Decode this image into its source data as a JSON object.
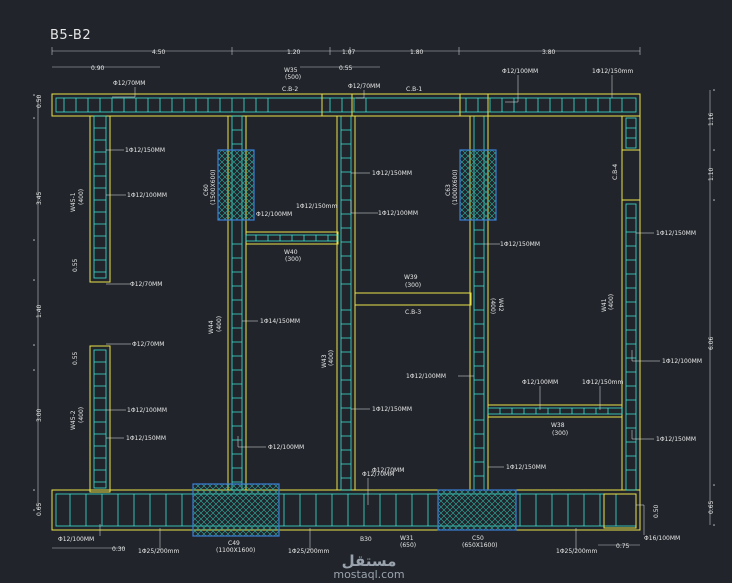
{
  "title": "B5-B2",
  "colors": {
    "background": "#21252b",
    "wall": "#e9e34a",
    "rebar": "#3fe3d4",
    "column": "#3a7fd6",
    "text": "#e6e6e6"
  },
  "dimensions": {
    "top_row": [
      "4.50",
      "1.20",
      "1.07",
      "1.80",
      "3.80"
    ],
    "second_row": [
      "0.90",
      "0.55"
    ],
    "left_col": [
      "0.50",
      "3.45",
      "0.55",
      "1.40",
      "0.55",
      "3.00",
      "0.65"
    ],
    "right_col": [
      "1.16",
      "1.10",
      "6.06",
      "0.65"
    ],
    "bottom": [
      "0.30",
      "0.75",
      "0.50"
    ]
  },
  "walls": {
    "w35": {
      "name": "W35",
      "size": "(500)"
    },
    "w40": {
      "name": "W40",
      "size": "(300)"
    },
    "w39": {
      "name": "W39",
      "size": "(300)"
    },
    "w38": {
      "name": "W38",
      "size": "(300)"
    },
    "w31": {
      "name": "W31",
      "size": "(650)"
    },
    "w30": {
      "name": "B30"
    },
    "w45_1": {
      "name": "W45-1",
      "size": "(400)"
    },
    "w45_2": {
      "name": "W45-2",
      "size": "(400)"
    },
    "w44": {
      "name": "W44",
      "size": "(400)"
    },
    "w43": {
      "name": "W43",
      "size": "(400)"
    },
    "w42": {
      "name": "W42",
      "size": "(400)"
    },
    "w41": {
      "name": "W41",
      "size": "(400)"
    }
  },
  "beams": [
    "C.B-2",
    "C.B-1",
    "C.B-3",
    "C.B-4"
  ],
  "columns": {
    "c60": {
      "name": "C60",
      "size": "(1500X600)"
    },
    "c63": {
      "name": "C63",
      "size": "(1000X600)"
    },
    "c49": {
      "name": "C49",
      "size": "(1100X1600)"
    },
    "c50": {
      "name": "C50",
      "size": "(650X1600)"
    }
  },
  "rebar_labels": {
    "r1": "Φ12/70MM",
    "r2": "Φ12/70MM",
    "r3": "Φ12/100MM",
    "r4": "1Φ12/150mm",
    "r5": "1Φ12/150MM",
    "r6": "1Φ12/100MM",
    "r7": "Φ12/70MM",
    "r8": "1Φ12/150MM",
    "r9": "Φ12/100MM",
    "r10": "1Φ12/150mm",
    "r11": "1Φ12/100MM",
    "r12": "1Φ12/150MM",
    "r13": "1Φ12/150MM",
    "r14": "Φ12/70MM",
    "r15": "1Φ14/150MM",
    "r16": "1Φ12/100MM",
    "r17": "Φ12/100MM",
    "r18": "1Φ12/150mm",
    "r19": "1Φ12/100MM",
    "r20": "Φ12/70MM",
    "r21": "1Φ12/100MM",
    "r22": "1Φ12/150MM",
    "r23": "1Φ12/150MM",
    "r24": "1Φ12/150MM",
    "r25": "Φ12/100MM",
    "r26": "1Φ12/150MM",
    "r27": "Φ12/70MM",
    "r28": "Φ12/100MM",
    "r29": "1Φ25/200mm",
    "r30": "1Φ25/200mm",
    "r31": "1Φ25/200mm",
    "r32": "Φ16/100MM",
    "r33": "Φ12/100MM"
  },
  "watermark": {
    "logo": "مستقل",
    "site": "mostaql.com"
  }
}
